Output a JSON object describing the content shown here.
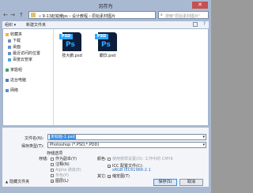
{
  "window": {
    "title": "另存为",
    "close": "✕"
  },
  "address": {
    "back_icon": "←",
    "forward_icon": "→",
    "up_icon": "↑",
    "path": "« 9-13赵锐耀ps   › 设计教程 › 原始素材图片",
    "search_placeholder": "搜索\"原始素材图片\""
  },
  "toolbar": {
    "organize": "组织 ▾",
    "new_folder": "新建文件夹"
  },
  "nav": [
    {
      "label": "收藏夹",
      "icon": "star-icon"
    },
    {
      "label": "下载",
      "icon": "download-icon"
    },
    {
      "label": "桌面",
      "icon": "desktop-icon"
    },
    {
      "label": "最近访问的位置",
      "icon": "recent-icon"
    },
    {
      "label": "百度云管家",
      "icon": "cloud-icon"
    },
    {
      "label": "家庭组",
      "icon": "homegroup-icon"
    },
    {
      "label": "这台电脑",
      "icon": "computer-icon"
    },
    {
      "label": "网络",
      "icon": "network-icon"
    }
  ],
  "files": [
    {
      "name": "技大鹏.psd",
      "banner": "PSD",
      "glyph": "Ps"
    },
    {
      "name": "霸饮.psd",
      "banner": "PSD",
      "glyph": "Ps"
    }
  ],
  "form": {
    "filename_label": "文件名(N):",
    "filename_value": "未标题-1.psd",
    "filetype_label": "保存类型(T):",
    "filetype_value": "Photoshop (*.PSD;*.PDD)",
    "save_options_label": "存储选项",
    "save_label": "存储:",
    "color_label": "颜色:",
    "opt_copy": "作为副本(Y)",
    "opt_notes": "注释(N)",
    "opt_alpha": "Alpha 通道(E)",
    "opt_spot": "专色(P)",
    "opt_layers": "图层(L)",
    "opt_proof": "使用校样设置(O): 工作中的 CMYK",
    "opt_icc": "ICC 配置文件(C):",
    "icc_value": "sRGB IEC61966-2.1",
    "opt_other": "其它:",
    "opt_thumb": "缩览图(T)",
    "hide_folders": "隐藏文件夹",
    "save_btn": "保存(S)",
    "cancel_btn": "取消"
  },
  "colors": {
    "accent": "#3a8ee6",
    "frame": "#a9b9d2",
    "ps_dark": "#0c1e3b",
    "ps_blue": "#31a8ff",
    "close_red": "#c75050"
  }
}
